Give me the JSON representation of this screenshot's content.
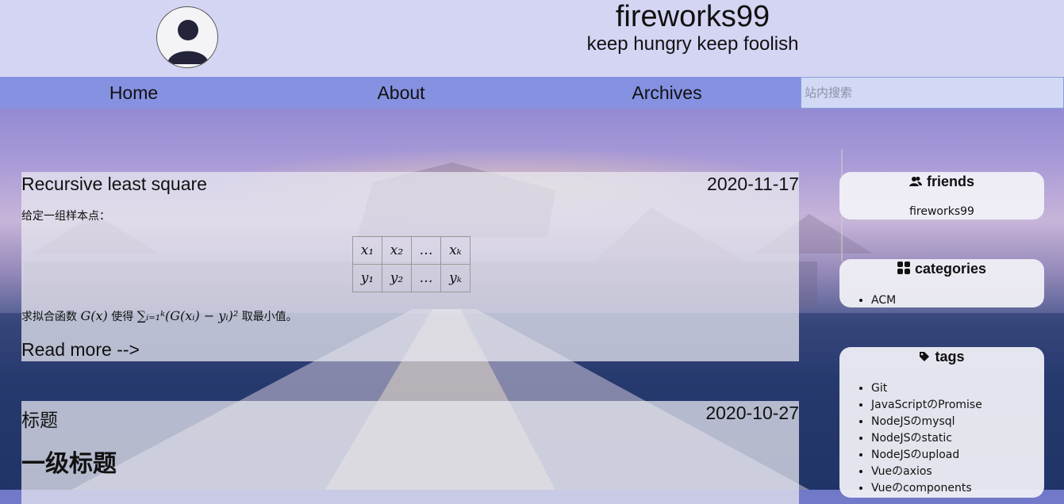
{
  "header": {
    "site_title": "fireworks99",
    "subtitle": "keep hungry keep foolish"
  },
  "nav": {
    "items": [
      "Home",
      "About",
      "Archives"
    ],
    "search_placeholder": "站内搜索"
  },
  "posts": [
    {
      "title": "Recursive least square",
      "date": "2020-11-17",
      "intro": "给定一组样本点：",
      "table": [
        [
          "x₁",
          "x₂",
          "…",
          "xₖ"
        ],
        [
          "y₁",
          "y₂",
          "…",
          "yₖ"
        ]
      ],
      "body": {
        "prefix": "求拟合函数",
        "function": "G(x)",
        "middle": "使得",
        "formula": "∑ᵢ₌₁ᵏ(G(xᵢ) − yᵢ)²",
        "suffix": "取最小值。"
      },
      "read_more": "Read more -->"
    },
    {
      "title": "标题",
      "date": "2020-10-27",
      "heading": "一级标题"
    }
  ],
  "widgets": {
    "friends": {
      "title": "friends",
      "icon": "user-group-icon",
      "items": [
        "fireworks99"
      ]
    },
    "categories": {
      "title": "categories",
      "icon": "grid-icon",
      "items": [
        "ACM"
      ]
    },
    "tags": {
      "title": "tags",
      "icon": "tag-icon",
      "items": [
        "Git",
        "JavaScriptのPromise",
        "NodeJSのmysql",
        "NodeJSのstatic",
        "NodeJSのupload",
        "Vueのaxios",
        "Vueのcomponents"
      ]
    }
  },
  "colors": {
    "header_bg": "#d4d5f3",
    "nav_bg": "#8296e6",
    "panel_bg": "#e8e8f0"
  }
}
